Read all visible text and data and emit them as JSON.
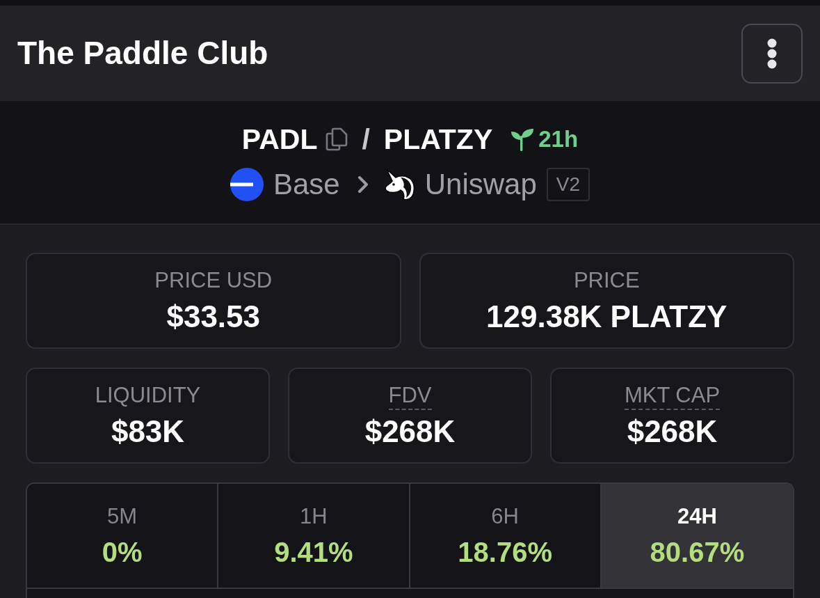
{
  "header": {
    "title": "The Paddle Club"
  },
  "pair": {
    "base_token": "PADL",
    "separator": "/",
    "quote_token": "PLATZY",
    "age": "21h",
    "chain": "Base",
    "dex": "Uniswap",
    "dex_version": "V2"
  },
  "price_cards": [
    {
      "label": "PRICE USD",
      "value": "$33.53",
      "underlined": false
    },
    {
      "label": "PRICE",
      "value": "129.38K PLATZY",
      "underlined": false
    }
  ],
  "stat_cards": [
    {
      "label": "LIQUIDITY",
      "value": "$83K",
      "underlined": false
    },
    {
      "label": "FDV",
      "value": "$268K",
      "underlined": true
    },
    {
      "label": "MKT CAP",
      "value": "$268K",
      "underlined": true
    }
  ],
  "timeframes": [
    {
      "label": "5M",
      "change": "0%",
      "selected": false
    },
    {
      "label": "1H",
      "change": "9.41%",
      "selected": false
    },
    {
      "label": "6H",
      "change": "18.76%",
      "selected": false
    },
    {
      "label": "24H",
      "change": "80.67%",
      "selected": true
    }
  ]
}
